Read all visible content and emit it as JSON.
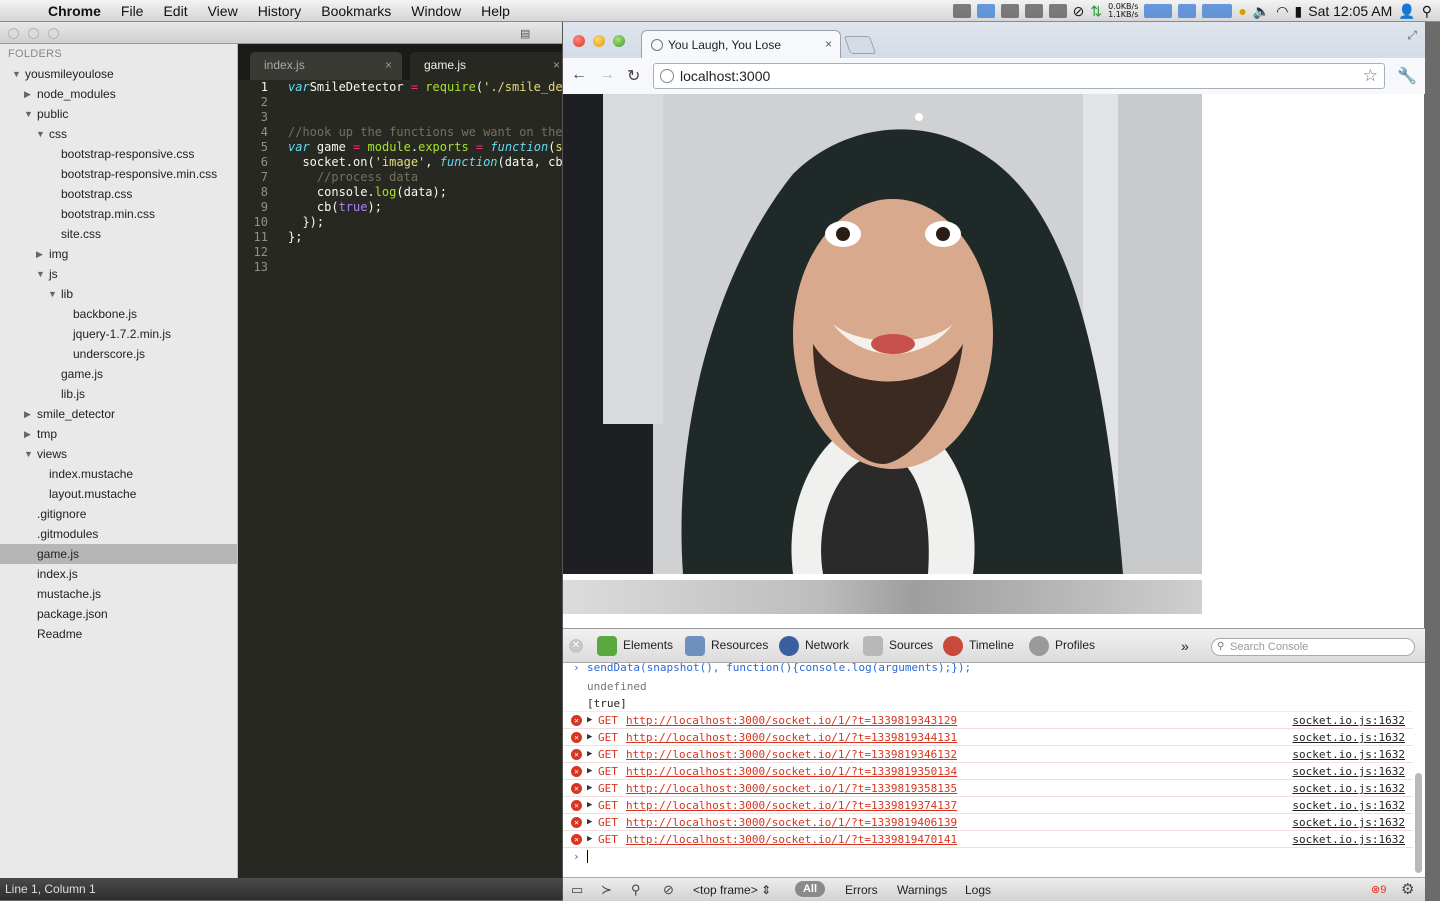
{
  "menubar": {
    "app": "Chrome",
    "items": [
      "File",
      "Edit",
      "View",
      "History",
      "Bookmarks",
      "Window",
      "Help"
    ],
    "net_down": "0.0KB/s",
    "net_up": "1.1KB/s",
    "clock": "Sat 12:05 AM"
  },
  "sublime": {
    "title_fragment": "game.",
    "sidebar": {
      "header": "FOLDERS",
      "tree": [
        {
          "label": "yousmileyoulose",
          "depth": 0,
          "state": "open"
        },
        {
          "label": "node_modules",
          "depth": 1,
          "state": "closed"
        },
        {
          "label": "public",
          "depth": 1,
          "state": "open"
        },
        {
          "label": "css",
          "depth": 2,
          "state": "open"
        },
        {
          "label": "bootstrap-responsive.css",
          "depth": 4,
          "state": "file"
        },
        {
          "label": "bootstrap-responsive.min.css",
          "depth": 4,
          "state": "file"
        },
        {
          "label": "bootstrap.css",
          "depth": 4,
          "state": "file"
        },
        {
          "label": "bootstrap.min.css",
          "depth": 4,
          "state": "file"
        },
        {
          "label": "site.css",
          "depth": 4,
          "state": "file"
        },
        {
          "label": "img",
          "depth": 2,
          "state": "closed"
        },
        {
          "label": "js",
          "depth": 2,
          "state": "open"
        },
        {
          "label": "lib",
          "depth": 3,
          "state": "open"
        },
        {
          "label": "backbone.js",
          "depth": 5,
          "state": "file"
        },
        {
          "label": "jquery-1.7.2.min.js",
          "depth": 5,
          "state": "file"
        },
        {
          "label": "underscore.js",
          "depth": 5,
          "state": "file"
        },
        {
          "label": "game.js",
          "depth": 4,
          "state": "file"
        },
        {
          "label": "lib.js",
          "depth": 4,
          "state": "file"
        },
        {
          "label": "smile_detector",
          "depth": 1,
          "state": "closed"
        },
        {
          "label": "tmp",
          "depth": 1,
          "state": "closed"
        },
        {
          "label": "views",
          "depth": 1,
          "state": "open"
        },
        {
          "label": "index.mustache",
          "depth": 3,
          "state": "file"
        },
        {
          "label": "layout.mustache",
          "depth": 3,
          "state": "file"
        },
        {
          "label": ".gitignore",
          "depth": 2,
          "state": "file"
        },
        {
          "label": ".gitmodules",
          "depth": 2,
          "state": "file"
        },
        {
          "label": "game.js",
          "depth": 2,
          "state": "file",
          "selected": true
        },
        {
          "label": "index.js",
          "depth": 2,
          "state": "file"
        },
        {
          "label": "mustache.js",
          "depth": 2,
          "state": "file"
        },
        {
          "label": "package.json",
          "depth": 2,
          "state": "file"
        },
        {
          "label": "Readme",
          "depth": 2,
          "state": "file"
        }
      ]
    },
    "tabs": [
      {
        "label": "index.js",
        "close": "×"
      },
      {
        "label": "game.js",
        "close": "×"
      }
    ],
    "code": [
      {
        "n": "1",
        "segs": [
          [
            "kw",
            "var"
          ],
          [
            "",
            "SmileDetector "
          ],
          [
            "op",
            "="
          ],
          [
            "",
            ""
          ],
          [
            "fn",
            " require"
          ],
          [
            "",
            "("
          ],
          [
            "str",
            "'./smile_de"
          ]
        ]
      },
      {
        "n": "2",
        "segs": []
      },
      {
        "n": "3",
        "segs": []
      },
      {
        "n": "4",
        "segs": [
          [
            "cm",
            "//hook up the functions we want on the"
          ]
        ]
      },
      {
        "n": "5",
        "segs": [
          [
            "kw",
            "var"
          ],
          [
            "",
            " game "
          ],
          [
            "op",
            "="
          ],
          [
            "",
            " "
          ],
          [
            "fn",
            "module"
          ],
          [
            "",
            "."
          ],
          [
            "fn",
            "exports"
          ],
          [
            "",
            " "
          ],
          [
            "op",
            "="
          ],
          [
            "",
            " "
          ],
          [
            "kw",
            "function"
          ],
          [
            "",
            "("
          ],
          [
            "str",
            "so"
          ]
        ]
      },
      {
        "n": "6",
        "segs": [
          [
            "",
            "  socket.on("
          ],
          [
            "str",
            "'image'"
          ],
          [
            ", "
          ],
          [
            "kw",
            "function"
          ],
          [
            "",
            "(data, cb)"
          ]
        ]
      },
      {
        "n": "7",
        "segs": [
          [
            "cm",
            "    //process data"
          ]
        ]
      },
      {
        "n": "8",
        "segs": [
          [
            "",
            "    console."
          ],
          [
            "fn",
            "log"
          ],
          [
            "",
            "(data);"
          ]
        ]
      },
      {
        "n": "9",
        "segs": [
          [
            "",
            "    cb("
          ],
          [
            "cn",
            "true"
          ],
          [
            "",
            ");"
          ]
        ]
      },
      {
        "n": "10",
        "segs": [
          [
            "",
            "  });"
          ]
        ]
      },
      {
        "n": "11",
        "segs": [
          [
            "",
            "};"
          ]
        ]
      },
      {
        "n": "12",
        "segs": []
      },
      {
        "n": "13",
        "segs": []
      }
    ],
    "status": "Line 1, Column 1"
  },
  "chrome": {
    "tab_title": "You Laugh, You Lose",
    "tab_close": "×",
    "url": "localhost:3000",
    "devtools": {
      "tabs": [
        "Elements",
        "Resources",
        "Network",
        "Sources",
        "Timeline",
        "Profiles"
      ],
      "more": "»",
      "search_placeholder": "Search Console",
      "prev_command": "sendData(snapshot(), function(){console.log(arguments);});",
      "result_undefined": "undefined",
      "result_true": "[true]",
      "errors": [
        {
          "method": "GET",
          "url": "http://localhost:3000/socket.io/1/?t=1339819343129",
          "source": "socket.io.js:1632"
        },
        {
          "method": "GET",
          "url": "http://localhost:3000/socket.io/1/?t=1339819344131",
          "source": "socket.io.js:1632"
        },
        {
          "method": "GET",
          "url": "http://localhost:3000/socket.io/1/?t=1339819346132",
          "source": "socket.io.js:1632"
        },
        {
          "method": "GET",
          "url": "http://localhost:3000/socket.io/1/?t=1339819350134",
          "source": "socket.io.js:1632"
        },
        {
          "method": "GET",
          "url": "http://localhost:3000/socket.io/1/?t=1339819358135",
          "source": "socket.io.js:1632"
        },
        {
          "method": "GET",
          "url": "http://localhost:3000/socket.io/1/?t=1339819374137",
          "source": "socket.io.js:1632"
        },
        {
          "method": "GET",
          "url": "http://localhost:3000/socket.io/1/?t=1339819406139",
          "source": "socket.io.js:1632"
        },
        {
          "method": "GET",
          "url": "http://localhost:3000/socket.io/1/?t=1339819470141",
          "source": "socket.io.js:1632"
        }
      ],
      "frame": "<top frame>",
      "levels": [
        "All",
        "Errors",
        "Warnings",
        "Logs"
      ],
      "error_count": "9"
    }
  },
  "colors": {
    "error": "#d8341f",
    "accent": "#2a6ad8",
    "editor_bg": "#272822"
  }
}
